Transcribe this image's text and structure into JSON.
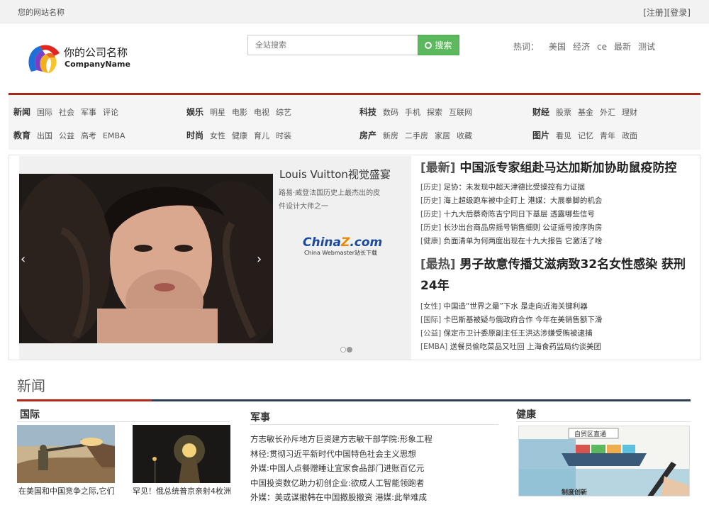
{
  "topbar": {
    "site_name": "您的网站名称",
    "register": "[注册]",
    "login": "[登录]"
  },
  "header": {
    "company_cn": "你的公司名称",
    "company_en": "CompanyName"
  },
  "search": {
    "placeholder": "全站搜索",
    "button": "搜索",
    "button_icon": "search-icon"
  },
  "hot": {
    "label": "热词：",
    "words": [
      "美国",
      "经济",
      "ce",
      "最新",
      "测试"
    ]
  },
  "nav": [
    {
      "head": "新闻",
      "items": [
        "国际",
        "社会",
        "军事",
        "评论"
      ]
    },
    {
      "head": "娱乐",
      "items": [
        "明星",
        "电影",
        "电视",
        "综艺"
      ]
    },
    {
      "head": "科技",
      "items": [
        "数码",
        "手机",
        "探索",
        "互联网"
      ]
    },
    {
      "head": "财经",
      "items": [
        "股票",
        "基金",
        "外汇",
        "理财"
      ]
    },
    {
      "head": "教育",
      "items": [
        "出国",
        "公益",
        "高考",
        "EMBA"
      ]
    },
    {
      "head": "时尚",
      "items": [
        "女性",
        "健康",
        "育儿",
        "时装"
      ]
    },
    {
      "head": "房产",
      "items": [
        "新房",
        "二手房",
        "家居",
        "收藏"
      ]
    },
    {
      "head": "图片",
      "items": [
        "看见",
        "记忆",
        "青年",
        "政面"
      ]
    }
  ],
  "slider": {
    "title": "Louis Vuitton视觉盛宴",
    "desc": "路易·威登法国历史上最杰出的皮件设计大师之一",
    "logo": "China",
    "logo_z": "Z",
    "logo_com": ".com",
    "logo_sub": "China Webmaster站长下载",
    "prev": "‹",
    "next": "›"
  },
  "latest": {
    "tag": "[最新]",
    "title": "中国派专家组赴马达加斯加协助鼠疫防控",
    "items": [
      {
        "cat": "[历史]",
        "text": "足协：未发现中超天津德比受操控有力证据"
      },
      {
        "cat": "[历史]",
        "text": "海上超级跑车被中企盯上 港媒：大展拳脚的机会"
      },
      {
        "cat": "[历史]",
        "text": "十九大后蔡奇陈吉宁同日下基层 透露哪些信号"
      },
      {
        "cat": "[历史]",
        "text": "长沙出台商品房摇号销售细则 公证摇号按序购房"
      },
      {
        "cat": "[健康]",
        "text": "负面清单为何两度出现在十九大报告 它激活了啥"
      }
    ]
  },
  "hotnews": {
    "tag": "[最热]",
    "title": "男子故意传播艾滋病致32名女性感染 获刑24年",
    "items": [
      {
        "cat": "[女性]",
        "text": "中国造“世界之最”下水 是走向近海关键利器"
      },
      {
        "cat": "[国际]",
        "text": "卡巴斯基被疑与俄政府合作 今年在美销售额下滑"
      },
      {
        "cat": "[公益]",
        "text": "保定市卫计委原副主任王洪达涉嫌受贿被逮捕"
      },
      {
        "cat": "[EMBA]",
        "text": "送餐员偷吃菜品又吐回 上海食药监局约谈美团"
      }
    ]
  },
  "section": {
    "title": "新闻",
    "intl": {
      "title": "国际",
      "cards": [
        {
          "caption": "在美国和中国竞争之际,它们"
        },
        {
          "caption": "罕见！俄总统普京亲射4枚洲"
        }
      ]
    },
    "military": {
      "title": "军事",
      "items": [
        "方志敏长孙斥地方巨资建方志敏干部学院:形象工程",
        "林径:贯彻习近平新时代中国特色社会主义思想",
        "外媒:中国人点餐赠睡让宜家食品部门进账百亿元",
        "中国投资数亿助力初创企业:欲成人工智能领跑者",
        "外媒：美或谋撤韩在中国撤股撤资 港媒:此举难成"
      ]
    },
    "health": {
      "title": "健康",
      "img_text_1": "自贸区直通",
      "img_text_2": "制度创新"
    }
  }
}
